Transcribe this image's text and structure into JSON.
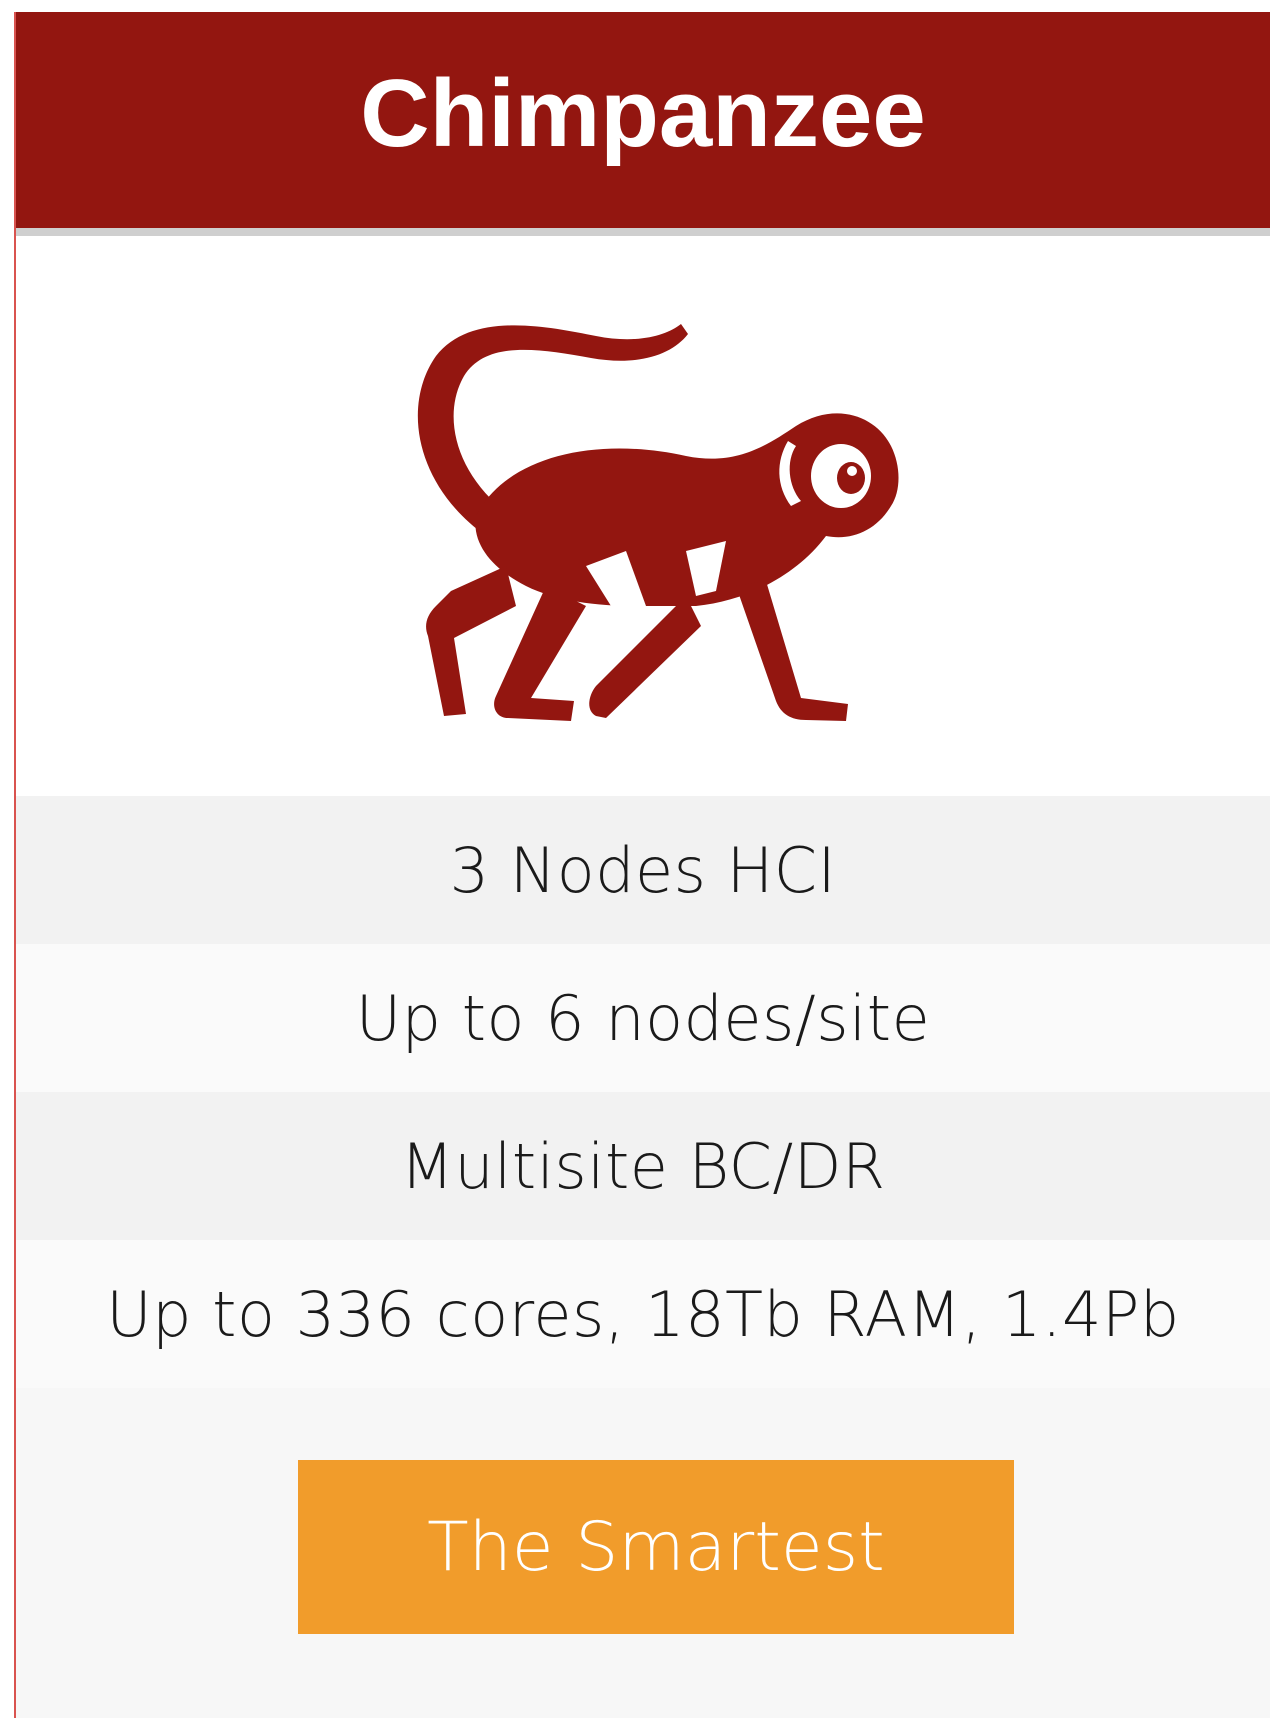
{
  "card": {
    "title": "Chimpanzee",
    "icon": "monkey-icon",
    "features": [
      "3 Nodes HCI",
      "Up to 6 nodes/site",
      "Multisite BC/DR",
      "Up to 336 cores, 18Tb RAM, 1.4Pb"
    ],
    "button_label": "The Smartest"
  },
  "colors": {
    "header": "#931610",
    "icon": "#931610",
    "button": "#f19c2b",
    "button_text": "#ffffff"
  }
}
